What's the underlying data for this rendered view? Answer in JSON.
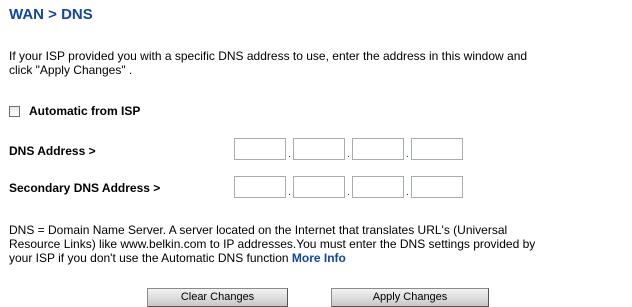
{
  "header": {
    "title": "WAN > DNS"
  },
  "intro": {
    "line1": "If your ISP provided you with a specific DNS address to use, enter the address in this window and",
    "line2": "click \"Apply Changes\" ."
  },
  "automatic": {
    "label": "Automatic from ISP",
    "checked": false
  },
  "dns": {
    "label": "DNS Address >",
    "octets": [
      "",
      "",
      "",
      ""
    ]
  },
  "secondary_dns": {
    "label": "Secondary DNS Address >",
    "octets": [
      "",
      "",
      "",
      ""
    ]
  },
  "description": {
    "line1": "DNS = Domain Name Server. A server located on the Internet that translates URL's (Universal",
    "line2": "Resource Links) like www.belkin.com to IP addresses.You must enter the DNS settings provided by",
    "line3": "your ISP if you don't use the Automatic DNS function ",
    "link": "More Info"
  },
  "buttons": {
    "clear": "Clear Changes",
    "apply": "Apply Changes"
  },
  "colors": {
    "title": "#1046a8",
    "link": "#1046a8"
  }
}
